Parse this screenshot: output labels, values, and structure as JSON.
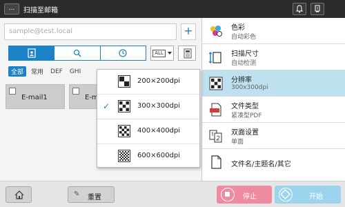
{
  "header": {
    "menu_label": "...",
    "title": "扫描至邮箱"
  },
  "address": {
    "placeholder": "sample@test.local",
    "add_label": "+"
  },
  "all_select": {
    "label": "ALL"
  },
  "filters": [
    "全部",
    "常用",
    "DEF",
    "GHI"
  ],
  "tiles": [
    {
      "label": "E-mail1"
    },
    {
      "label": "E-ma"
    }
  ],
  "resolution_popup": {
    "selected_index": 1,
    "check_glyph": "✓",
    "options": [
      "200×200dpi",
      "300×300dpi",
      "400×400dpi",
      "600×600dpi"
    ]
  },
  "settings": [
    {
      "icon": "color-icon",
      "title": "色彩",
      "value": "自动彩色"
    },
    {
      "icon": "scan-size-icon",
      "title": "扫描尺寸",
      "value": "自动检测"
    },
    {
      "icon": "resolution-icon",
      "title": "分辨率",
      "value": "300x300dpi"
    },
    {
      "icon": "file-type-icon",
      "title": "文件类型",
      "value": "紧凑型PDF"
    },
    {
      "icon": "duplex-icon",
      "title": "双面设置",
      "value": "单面"
    },
    {
      "icon": "document-icon",
      "title": "文件名/主题名/其它",
      "value": ""
    }
  ],
  "footer": {
    "reset_label": "重置",
    "stop_label": "停止",
    "start_label": "开始"
  },
  "colors": {
    "accent": "#1a82c5",
    "selected_row": "#bfe0ee",
    "stop": "#f08aa0",
    "start": "#9bd4ec",
    "header": "#2b2b2b"
  }
}
